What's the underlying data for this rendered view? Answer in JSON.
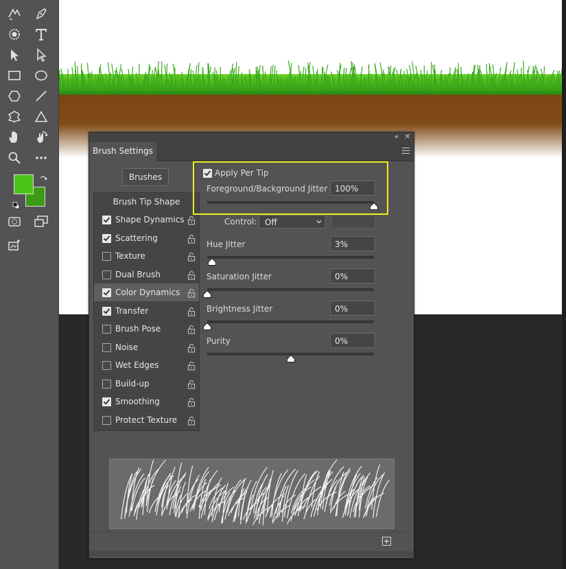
{
  "panel": {
    "tab_label": "Brush Settings",
    "collapse_glyph": "«",
    "close_glyph": "✕",
    "brushes_button": "Brushes"
  },
  "sidebar": {
    "header": "Brush Tip Shape",
    "items": [
      {
        "label": "Shape Dynamics",
        "checked": true
      },
      {
        "label": "Scattering",
        "checked": true
      },
      {
        "label": "Texture",
        "checked": false
      },
      {
        "label": "Dual Brush",
        "checked": false
      },
      {
        "label": "Color Dynamics",
        "checked": true,
        "active": true
      },
      {
        "label": "Transfer",
        "checked": true
      },
      {
        "label": "Brush Pose",
        "checked": false
      },
      {
        "label": "Noise",
        "checked": false
      },
      {
        "label": "Wet Edges",
        "checked": false
      },
      {
        "label": "Build-up",
        "checked": false
      },
      {
        "label": "Smoothing",
        "checked": true
      },
      {
        "label": "Protect Texture",
        "checked": false
      }
    ]
  },
  "color_dynamics": {
    "apply_per_tip": {
      "label": "Apply Per Tip",
      "checked": true
    },
    "fg_bg_jitter": {
      "label": "Foreground/Background Jitter",
      "value": "100%",
      "level": 1.0
    },
    "control": {
      "label": "Control:",
      "value": "Off"
    },
    "hue_jitter": {
      "label": "Hue Jitter",
      "value": "3%",
      "level": 0.03
    },
    "saturation_jitter": {
      "label": "Saturation Jitter",
      "value": "0%",
      "level": 0.0
    },
    "brightness_jitter": {
      "label": "Brightness Jitter",
      "value": "0%",
      "level": 0.0
    },
    "purity": {
      "label": "Purity",
      "value": "0%",
      "level": 0.5
    }
  },
  "colors": {
    "foreground": "#4cc41a",
    "background": "#3c9a14",
    "highlight": "#eeee22",
    "grass": "#3aa81a",
    "soil": "#7a4410"
  },
  "tools": [
    "content-aware-move-icon",
    "pen-icon",
    "blob-icon",
    "type-icon",
    "path-selection-icon",
    "direct-selection-icon",
    "rectangle-icon",
    "ellipse-icon",
    "polygon-icon",
    "line-icon",
    "custom-shape-icon",
    "triangle-icon",
    "hand-icon",
    "rotate-view-icon",
    "zoom-icon",
    "more-tools-icon",
    "quick-mask-icon",
    "screen-mode-icon",
    "frame-icon"
  ]
}
